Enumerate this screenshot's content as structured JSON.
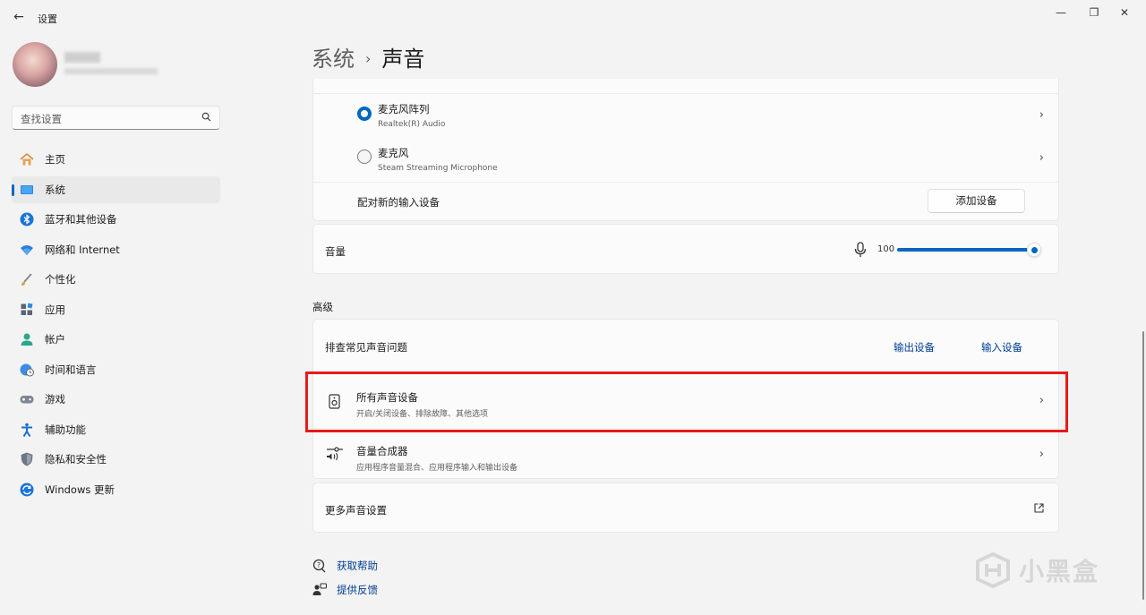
{
  "window": {
    "app_title": "设置",
    "minimize_glyph": "—",
    "maximize_glyph": "❐",
    "close_glyph": "✕",
    "back_glyph": "←"
  },
  "sidebar": {
    "search_placeholder": "查找设置",
    "items": [
      {
        "label": "主页",
        "icon": "home-icon"
      },
      {
        "label": "系统",
        "icon": "system-icon",
        "active": true
      },
      {
        "label": "蓝牙和其他设备",
        "icon": "bluetooth-icon"
      },
      {
        "label": "网络和 Internet",
        "icon": "wifi-icon"
      },
      {
        "label": "个性化",
        "icon": "brush-icon"
      },
      {
        "label": "应用",
        "icon": "apps-icon"
      },
      {
        "label": "帐户",
        "icon": "account-icon"
      },
      {
        "label": "时间和语言",
        "icon": "globe-clock-icon"
      },
      {
        "label": "游戏",
        "icon": "gamepad-icon"
      },
      {
        "label": "辅助功能",
        "icon": "accessibility-icon"
      },
      {
        "label": "隐私和安全性",
        "icon": "shield-icon"
      },
      {
        "label": "Windows 更新",
        "icon": "update-icon"
      }
    ]
  },
  "header": {
    "parent": "系统",
    "separator": "›",
    "current": "声音"
  },
  "input_devices": {
    "devices": [
      {
        "name": "麦克风阵列",
        "sub": "Realtek(R) Audio",
        "selected": true
      },
      {
        "name": "麦克风",
        "sub": "Steam Streaming Microphone",
        "selected": false
      }
    ],
    "pair_label": "配对新的输入设备",
    "add_button": "添加设备"
  },
  "volume": {
    "label": "音量",
    "value": "100",
    "level": 1.0
  },
  "advanced": {
    "section_label": "高级",
    "troubleshoot_label": "排查常见声音问题",
    "output_link": "输出设备",
    "input_link": "输入设备",
    "all_devices_title": "所有声音设备",
    "all_devices_sub": "开启/关闭设备、排除故障、其他选项",
    "mixer_title": "音量合成器",
    "mixer_sub": "应用程序音量混合、应用程序输入和输出设备",
    "more_settings": "更多声音设置"
  },
  "help": {
    "get_help": "获取帮助",
    "feedback": "提供反馈"
  },
  "watermark": {
    "text": "小黑盒"
  },
  "colors": {
    "accent": "#0067c0",
    "highlight": "#e81a1a",
    "link": "#003e92"
  }
}
